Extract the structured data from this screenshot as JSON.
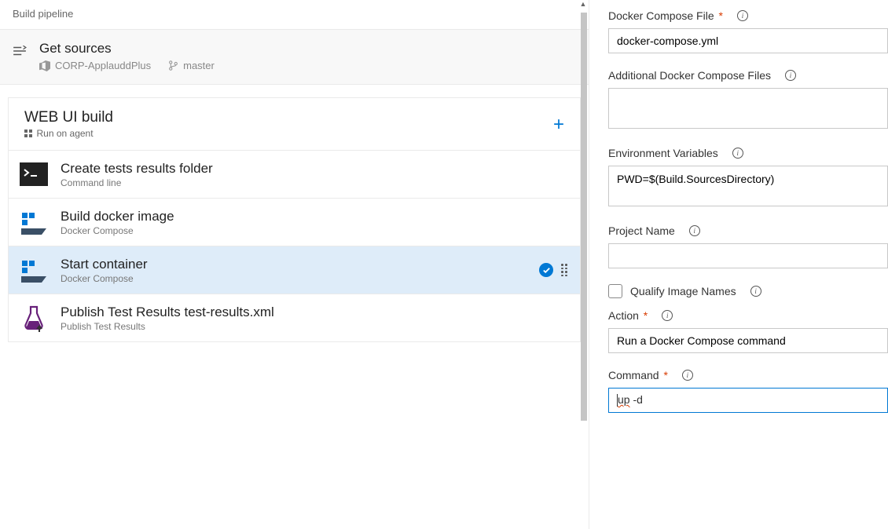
{
  "header": {
    "title": "Build pipeline"
  },
  "sources": {
    "title": "Get sources",
    "repo": "CORP-ApplauddPlus",
    "branch": "master"
  },
  "agent": {
    "title": "WEB UI build",
    "sub": "Run on agent"
  },
  "tasks": [
    {
      "title": "Create tests results folder",
      "sub": "Command line",
      "icon": "terminal",
      "selected": false
    },
    {
      "title": "Build docker image",
      "sub": "Docker Compose",
      "icon": "compose",
      "selected": false
    },
    {
      "title": "Start container",
      "sub": "Docker Compose",
      "icon": "compose",
      "selected": true
    },
    {
      "title": "Publish Test Results test-results.xml",
      "sub": "Publish Test Results",
      "icon": "publish",
      "selected": false
    }
  ],
  "form": {
    "docker_compose_file": {
      "label": "Docker Compose File",
      "value": "docker-compose.yml"
    },
    "additional_files": {
      "label": "Additional Docker Compose Files",
      "value": ""
    },
    "env_vars": {
      "label": "Environment Variables",
      "value": "PWD=$(Build.SourcesDirectory)"
    },
    "project_name": {
      "label": "Project Name",
      "value": ""
    },
    "qualify": {
      "label": "Qualify Image Names",
      "checked": false
    },
    "action": {
      "label": "Action",
      "value": "Run a Docker Compose command"
    },
    "command": {
      "label": "Command",
      "value": "up -d",
      "display_prefix": "up",
      "display_suffix": " -d"
    }
  }
}
